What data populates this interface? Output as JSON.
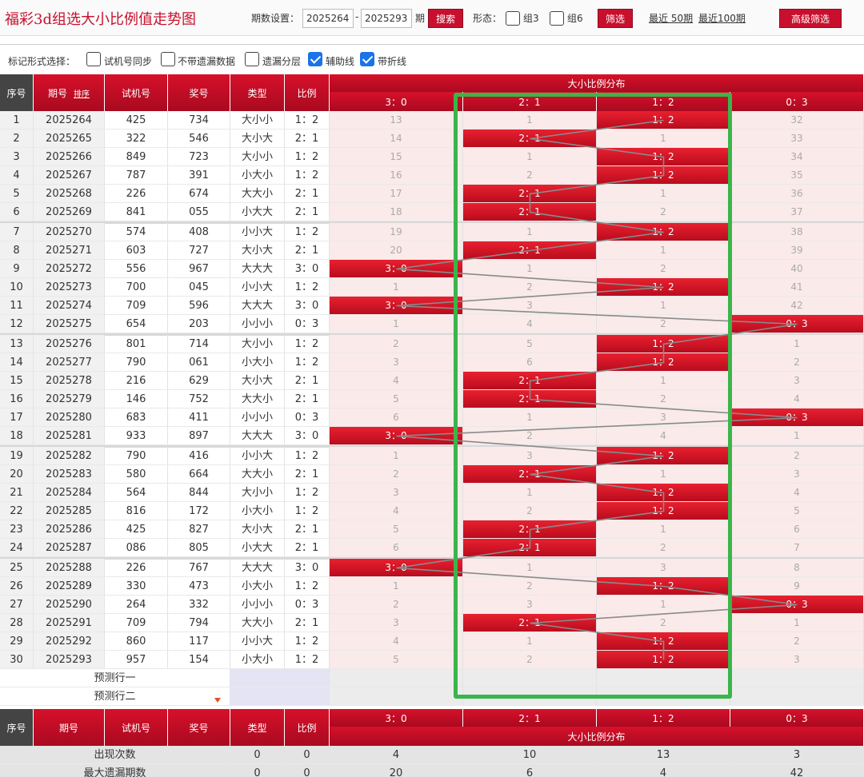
{
  "header": {
    "title": "福彩3d组选大小比例值走势图",
    "period_label": "期数设置：",
    "period_from": "2025264",
    "period_to": "2025293",
    "period_suffix": "期",
    "search_label": "搜索",
    "form_label": "形态：",
    "group3_label": "组3",
    "group6_label": "组6",
    "filter_label": "筛选",
    "recent50": "最近 50期",
    "recent100": "最近100期",
    "advanced_label": "高级筛选"
  },
  "options": {
    "mark_label": "标记形式选择：",
    "items": [
      {
        "label": "试机号同步",
        "checked": false
      },
      {
        "label": "不带遗漏数据",
        "checked": false
      },
      {
        "label": "遗漏分层",
        "checked": false
      },
      {
        "label": "辅助线",
        "checked": true
      },
      {
        "label": "带折线",
        "checked": true
      }
    ]
  },
  "table": {
    "headers": {
      "seq": "序号",
      "period": "期号",
      "sort": "排序",
      "trial": "试机号",
      "prize": "奖号",
      "type": "类型",
      "ratio": "比例",
      "dist": "大小比例分布",
      "ratio_cols": [
        "3：0",
        "2：1",
        "1：2",
        "0：3"
      ]
    },
    "rows": [
      {
        "seq": "1",
        "period": "2025264",
        "trial": "425",
        "prize": "734",
        "type": "大小小",
        "ratio": "1：2",
        "hit": 2,
        "dist": [
          "13",
          "1",
          "1：2",
          "32"
        ]
      },
      {
        "seq": "2",
        "period": "2025265",
        "trial": "322",
        "prize": "546",
        "type": "大小大",
        "ratio": "2：1",
        "hit": 1,
        "dist": [
          "14",
          "2：1",
          "1",
          "33"
        ]
      },
      {
        "seq": "3",
        "period": "2025266",
        "trial": "849",
        "prize": "723",
        "type": "大小小",
        "ratio": "1：2",
        "hit": 2,
        "dist": [
          "15",
          "1",
          "1：2",
          "34"
        ]
      },
      {
        "seq": "4",
        "period": "2025267",
        "trial": "787",
        "prize": "391",
        "type": "小大小",
        "ratio": "1：2",
        "hit": 2,
        "dist": [
          "16",
          "2",
          "1：2",
          "35"
        ]
      },
      {
        "seq": "5",
        "period": "2025268",
        "trial": "226",
        "prize": "674",
        "type": "大大小",
        "ratio": "2：1",
        "hit": 1,
        "dist": [
          "17",
          "2：1",
          "1",
          "36"
        ]
      },
      {
        "seq": "6",
        "period": "2025269",
        "trial": "841",
        "prize": "055",
        "type": "小大大",
        "ratio": "2：1",
        "hit": 1,
        "dist": [
          "18",
          "2：1",
          "2",
          "37"
        ]
      },
      {
        "seq": "7",
        "period": "2025270",
        "trial": "574",
        "prize": "408",
        "type": "小小大",
        "ratio": "1：2",
        "hit": 2,
        "dist": [
          "19",
          "1",
          "1：2",
          "38"
        ]
      },
      {
        "seq": "8",
        "period": "2025271",
        "trial": "603",
        "prize": "727",
        "type": "大小大",
        "ratio": "2：1",
        "hit": 1,
        "dist": [
          "20",
          "2：1",
          "1",
          "39"
        ]
      },
      {
        "seq": "9",
        "period": "2025272",
        "trial": "556",
        "prize": "967",
        "type": "大大大",
        "ratio": "3：0",
        "hit": 0,
        "dist": [
          "3：0",
          "1",
          "2",
          "40"
        ]
      },
      {
        "seq": "10",
        "period": "2025273",
        "trial": "700",
        "prize": "045",
        "type": "小小大",
        "ratio": "1：2",
        "hit": 2,
        "dist": [
          "1",
          "2",
          "1：2",
          "41"
        ]
      },
      {
        "seq": "11",
        "period": "2025274",
        "trial": "709",
        "prize": "596",
        "type": "大大大",
        "ratio": "3：0",
        "hit": 0,
        "dist": [
          "3：0",
          "3",
          "1",
          "42"
        ]
      },
      {
        "seq": "12",
        "period": "2025275",
        "trial": "654",
        "prize": "203",
        "type": "小小小",
        "ratio": "0：3",
        "hit": 3,
        "dist": [
          "1",
          "4",
          "2",
          "0：3"
        ]
      },
      {
        "seq": "13",
        "period": "2025276",
        "trial": "801",
        "prize": "714",
        "type": "大小小",
        "ratio": "1：2",
        "hit": 2,
        "dist": [
          "2",
          "5",
          "1：2",
          "1"
        ]
      },
      {
        "seq": "14",
        "period": "2025277",
        "trial": "790",
        "prize": "061",
        "type": "小大小",
        "ratio": "1：2",
        "hit": 2,
        "dist": [
          "3",
          "6",
          "1：2",
          "2"
        ]
      },
      {
        "seq": "15",
        "period": "2025278",
        "trial": "216",
        "prize": "629",
        "type": "大小大",
        "ratio": "2：1",
        "hit": 1,
        "dist": [
          "4",
          "2：1",
          "1",
          "3"
        ]
      },
      {
        "seq": "16",
        "period": "2025279",
        "trial": "146",
        "prize": "752",
        "type": "大大小",
        "ratio": "2：1",
        "hit": 1,
        "dist": [
          "5",
          "2：1",
          "2",
          "4"
        ]
      },
      {
        "seq": "17",
        "period": "2025280",
        "trial": "683",
        "prize": "411",
        "type": "小小小",
        "ratio": "0：3",
        "hit": 3,
        "dist": [
          "6",
          "1",
          "3",
          "0：3"
        ]
      },
      {
        "seq": "18",
        "period": "2025281",
        "trial": "933",
        "prize": "897",
        "type": "大大大",
        "ratio": "3：0",
        "hit": 0,
        "dist": [
          "3：0",
          "2",
          "4",
          "1"
        ]
      },
      {
        "seq": "19",
        "period": "2025282",
        "trial": "790",
        "prize": "416",
        "type": "小小大",
        "ratio": "1：2",
        "hit": 2,
        "dist": [
          "1",
          "3",
          "1：2",
          "2"
        ]
      },
      {
        "seq": "20",
        "period": "2025283",
        "trial": "580",
        "prize": "664",
        "type": "大大小",
        "ratio": "2：1",
        "hit": 1,
        "dist": [
          "2",
          "2：1",
          "1",
          "3"
        ]
      },
      {
        "seq": "21",
        "period": "2025284",
        "trial": "564",
        "prize": "844",
        "type": "大小小",
        "ratio": "1：2",
        "hit": 2,
        "dist": [
          "3",
          "1",
          "1：2",
          "4"
        ]
      },
      {
        "seq": "22",
        "period": "2025285",
        "trial": "816",
        "prize": "172",
        "type": "小大小",
        "ratio": "1：2",
        "hit": 2,
        "dist": [
          "4",
          "2",
          "1：2",
          "5"
        ]
      },
      {
        "seq": "23",
        "period": "2025286",
        "trial": "425",
        "prize": "827",
        "type": "大小大",
        "ratio": "2：1",
        "hit": 1,
        "dist": [
          "5",
          "2：1",
          "1",
          "6"
        ]
      },
      {
        "seq": "24",
        "period": "2025287",
        "trial": "086",
        "prize": "805",
        "type": "小大大",
        "ratio": "2：1",
        "hit": 1,
        "dist": [
          "6",
          "2：1",
          "2",
          "7"
        ]
      },
      {
        "seq": "25",
        "period": "2025288",
        "trial": "226",
        "prize": "767",
        "type": "大大大",
        "ratio": "3：0",
        "hit": 0,
        "dist": [
          "3：0",
          "1",
          "3",
          "8"
        ]
      },
      {
        "seq": "26",
        "period": "2025289",
        "trial": "330",
        "prize": "473",
        "type": "小大小",
        "ratio": "1：2",
        "hit": 2,
        "dist": [
          "1",
          "2",
          "1：2",
          "9"
        ]
      },
      {
        "seq": "27",
        "period": "2025290",
        "trial": "264",
        "prize": "332",
        "type": "小小小",
        "ratio": "0：3",
        "hit": 3,
        "dist": [
          "2",
          "3",
          "1",
          "0：3"
        ]
      },
      {
        "seq": "28",
        "period": "2025291",
        "trial": "709",
        "prize": "794",
        "type": "大大小",
        "ratio": "2：1",
        "hit": 1,
        "dist": [
          "3",
          "2：1",
          "2",
          "1"
        ]
      },
      {
        "seq": "29",
        "period": "2025292",
        "trial": "860",
        "prize": "117",
        "type": "小小大",
        "ratio": "1：2",
        "hit": 2,
        "dist": [
          "4",
          "1",
          "1：2",
          "2"
        ]
      },
      {
        "seq": "30",
        "period": "2025293",
        "trial": "957",
        "prize": "154",
        "type": "小大小",
        "ratio": "1：2",
        "hit": 2,
        "dist": [
          "5",
          "2",
          "1：2",
          "3"
        ]
      }
    ],
    "predict1": "预测行一",
    "predict2": "预测行二",
    "stats": [
      {
        "label": "出现次数",
        "type": "0",
        "ratio": "0",
        "vals": [
          "4",
          "10",
          "13",
          "3"
        ]
      },
      {
        "label": "最大遗漏期数",
        "type": "0",
        "ratio": "0",
        "vals": [
          "20",
          "6",
          "4",
          "42"
        ]
      }
    ]
  },
  "colors": {
    "accent": "#c8102e",
    "highlight_box": "#3ab54a",
    "pink": "#fbeaea"
  }
}
